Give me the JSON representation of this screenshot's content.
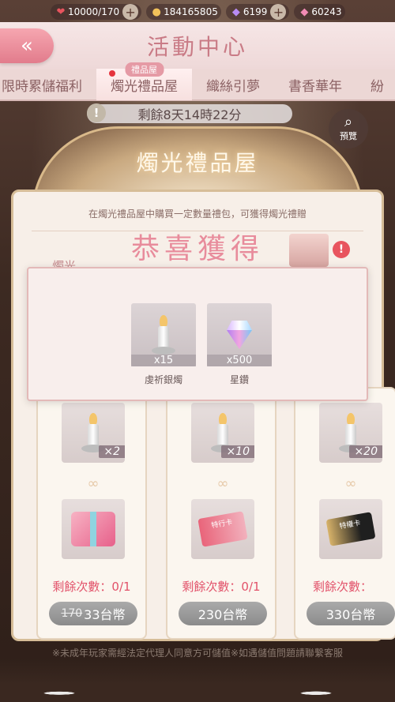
{
  "resources": [
    {
      "icon": "heart-icon",
      "value": "10000/170"
    },
    {
      "icon": "cat-coin-icon",
      "value": "184165805"
    },
    {
      "icon": "star-diamond-icon",
      "value": "6199"
    },
    {
      "icon": "pink-diamond-icon",
      "value": "60243"
    }
  ],
  "header": {
    "title": "活動中心"
  },
  "tabs": [
    {
      "label": "限時累儲福利"
    },
    {
      "label": "燭光禮品屋",
      "badge": "禮品屋",
      "active": true
    },
    {
      "label": "織絲引夢"
    },
    {
      "label": "書香華年"
    },
    {
      "label": "紛"
    }
  ],
  "countdown": "剩餘8天14時22分",
  "preview_label": "預覽",
  "event": {
    "title": "燭光禮品屋",
    "description": "在燭光禮品屋中購買一定數量禮包，可獲得燭光禮贈",
    "congrats": "恭喜獲得",
    "partial_label": "燭光"
  },
  "popup": {
    "rewards": [
      {
        "icon": "silver-candle-icon",
        "count": "x15",
        "label": "虔祈銀燭"
      },
      {
        "icon": "star-diamond-icon",
        "count": "x500",
        "label": "星鑽"
      }
    ]
  },
  "packages": [
    {
      "candle_qty": "×2",
      "item": "gift-box-icon",
      "remain": "剩餘次數：0/1",
      "old_price": "170",
      "price": "33台幣"
    },
    {
      "candle_qty": "×10",
      "item": "red-card-icon",
      "item_text": "特行卡",
      "remain": "剩餘次數：0/1",
      "price": "230台幣"
    },
    {
      "candle_qty": "×20",
      "item": "gold-card-icon",
      "item_text": "特權卡",
      "remain": "剩餘次數：",
      "price": "330台幣"
    }
  ],
  "footer": "※未成年玩家需經法定代理人同意方可儲值※如遇儲值問題請聯繫客服"
}
